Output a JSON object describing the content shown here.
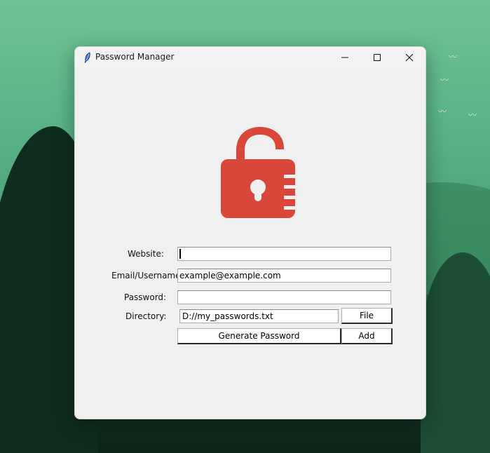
{
  "window": {
    "title": "Password Manager"
  },
  "form": {
    "website_label": "Website:",
    "website_value": "",
    "email_label": "Email/Username:",
    "email_value": "example@example.com",
    "password_label": "Password:",
    "password_value": "",
    "directory_label": "Directory:",
    "directory_value": "D://my_passwords.txt"
  },
  "buttons": {
    "file": "File",
    "generate": "Generate Password",
    "add": "Add"
  },
  "icons": {
    "app": "feather-icon",
    "minimize": "minimize-icon",
    "maximize": "maximize-icon",
    "close": "close-icon",
    "logo": "unlocked-padlock-icon"
  },
  "colors": {
    "lock": "#d9473b",
    "window_bg": "#f0f0f0"
  }
}
